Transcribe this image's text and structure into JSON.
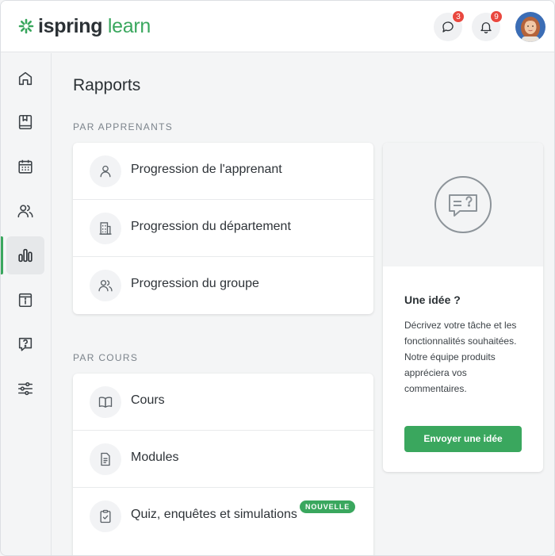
{
  "app": {
    "logo_primary": "ispring",
    "logo_secondary": "learn",
    "brand_color": "#3aa75e"
  },
  "header": {
    "messages": {
      "icon": "chat-icon",
      "count": "3"
    },
    "notifications": {
      "icon": "bell-icon",
      "count": "9"
    },
    "avatar": "user-avatar"
  },
  "sidebar": {
    "items": [
      {
        "icon": "home-icon",
        "active": false
      },
      {
        "icon": "book-icon",
        "active": false
      },
      {
        "icon": "calendar-icon",
        "active": false
      },
      {
        "icon": "users-icon",
        "active": false
      },
      {
        "icon": "bar-chart-icon",
        "active": true
      },
      {
        "icon": "info-box-icon",
        "active": false
      },
      {
        "icon": "question-icon",
        "active": false
      },
      {
        "icon": "sliders-icon",
        "active": false
      }
    ]
  },
  "main": {
    "title": "Rapports",
    "sections": [
      {
        "label": "PAR APPRENANTS",
        "items": [
          {
            "label": "Progression de l'apprenant",
            "icon": "user-icon"
          },
          {
            "label": "Progression du département",
            "icon": "building-icon"
          },
          {
            "label": "Progression du groupe",
            "icon": "group-icon"
          }
        ]
      },
      {
        "label": "PAR COURS",
        "items": [
          {
            "label": "Cours",
            "icon": "open-book-icon"
          },
          {
            "label": "Modules",
            "icon": "document-icon"
          },
          {
            "label": "Quiz, enquêtes et simulations",
            "icon": "checklist-icon",
            "badge": "NOUVELLE"
          }
        ]
      }
    ]
  },
  "idea": {
    "icon": "speech-bubble-question-icon",
    "title": "Une idée ?",
    "text": "Décrivez votre tâche et les fonctionnalités souhaitées. Notre équipe produits appréciera vos commentaires.",
    "button": "Envoyer une idée"
  }
}
